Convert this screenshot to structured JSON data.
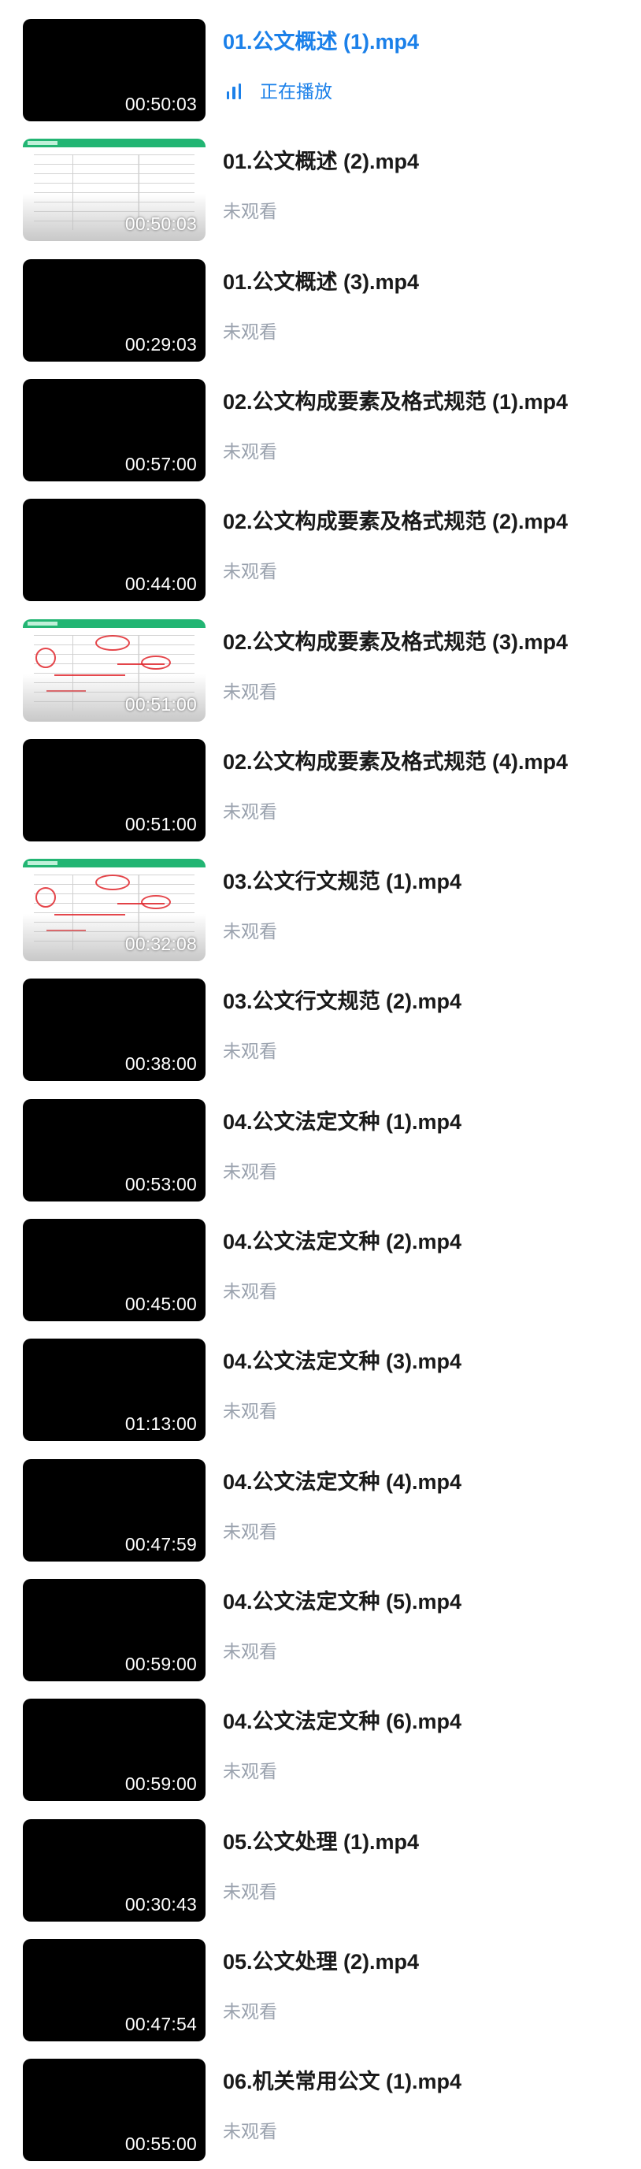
{
  "playlist": {
    "now_playing_label": "正在播放",
    "unwatched_label": "未观看",
    "accent_color": "#1b80e9",
    "items": [
      {
        "title": "01.公文概述 (1).mp4",
        "duration": "00:50:03",
        "status": "正在播放",
        "thumbnail": "black",
        "active": true
      },
      {
        "title": "01.公文概述 (2).mp4",
        "duration": "00:50:03",
        "status": "未观看",
        "thumbnail": "slide"
      },
      {
        "title": "01.公文概述 (3).mp4",
        "duration": "00:29:03",
        "status": "未观看",
        "thumbnail": "black"
      },
      {
        "title": "02.公文构成要素及格式规范 (1).mp4",
        "duration": "00:57:00",
        "status": "未观看",
        "thumbnail": "black"
      },
      {
        "title": "02.公文构成要素及格式规范 (2).mp4",
        "duration": "00:44:00",
        "status": "未观看",
        "thumbnail": "black"
      },
      {
        "title": "02.公文构成要素及格式规范 (3).mp4",
        "duration": "00:51:00",
        "status": "未观看",
        "thumbnail": "slide-annotated"
      },
      {
        "title": "02.公文构成要素及格式规范 (4).mp4",
        "duration": "00:51:00",
        "status": "未观看",
        "thumbnail": "black"
      },
      {
        "title": "03.公文行文规范 (1).mp4",
        "duration": "00:32:08",
        "status": "未观看",
        "thumbnail": "slide-annotated"
      },
      {
        "title": "03.公文行文规范 (2).mp4",
        "duration": "00:38:00",
        "status": "未观看",
        "thumbnail": "black"
      },
      {
        "title": "04.公文法定文种 (1).mp4",
        "duration": "00:53:00",
        "status": "未观看",
        "thumbnail": "black"
      },
      {
        "title": "04.公文法定文种 (2).mp4",
        "duration": "00:45:00",
        "status": "未观看",
        "thumbnail": "black"
      },
      {
        "title": "04.公文法定文种 (3).mp4",
        "duration": "01:13:00",
        "status": "未观看",
        "thumbnail": "black"
      },
      {
        "title": "04.公文法定文种 (4).mp4",
        "duration": "00:47:59",
        "status": "未观看",
        "thumbnail": "black"
      },
      {
        "title": "04.公文法定文种 (5).mp4",
        "duration": "00:59:00",
        "status": "未观看",
        "thumbnail": "black"
      },
      {
        "title": "04.公文法定文种 (6).mp4",
        "duration": "00:59:00",
        "status": "未观看",
        "thumbnail": "black"
      },
      {
        "title": "05.公文处理 (1).mp4",
        "duration": "00:30:43",
        "status": "未观看",
        "thumbnail": "black"
      },
      {
        "title": "05.公文处理 (2).mp4",
        "duration": "00:47:54",
        "status": "未观看",
        "thumbnail": "black"
      },
      {
        "title": "06.机关常用公文 (1).mp4",
        "duration": "00:55:00",
        "status": "未观看",
        "thumbnail": "black"
      }
    ]
  }
}
